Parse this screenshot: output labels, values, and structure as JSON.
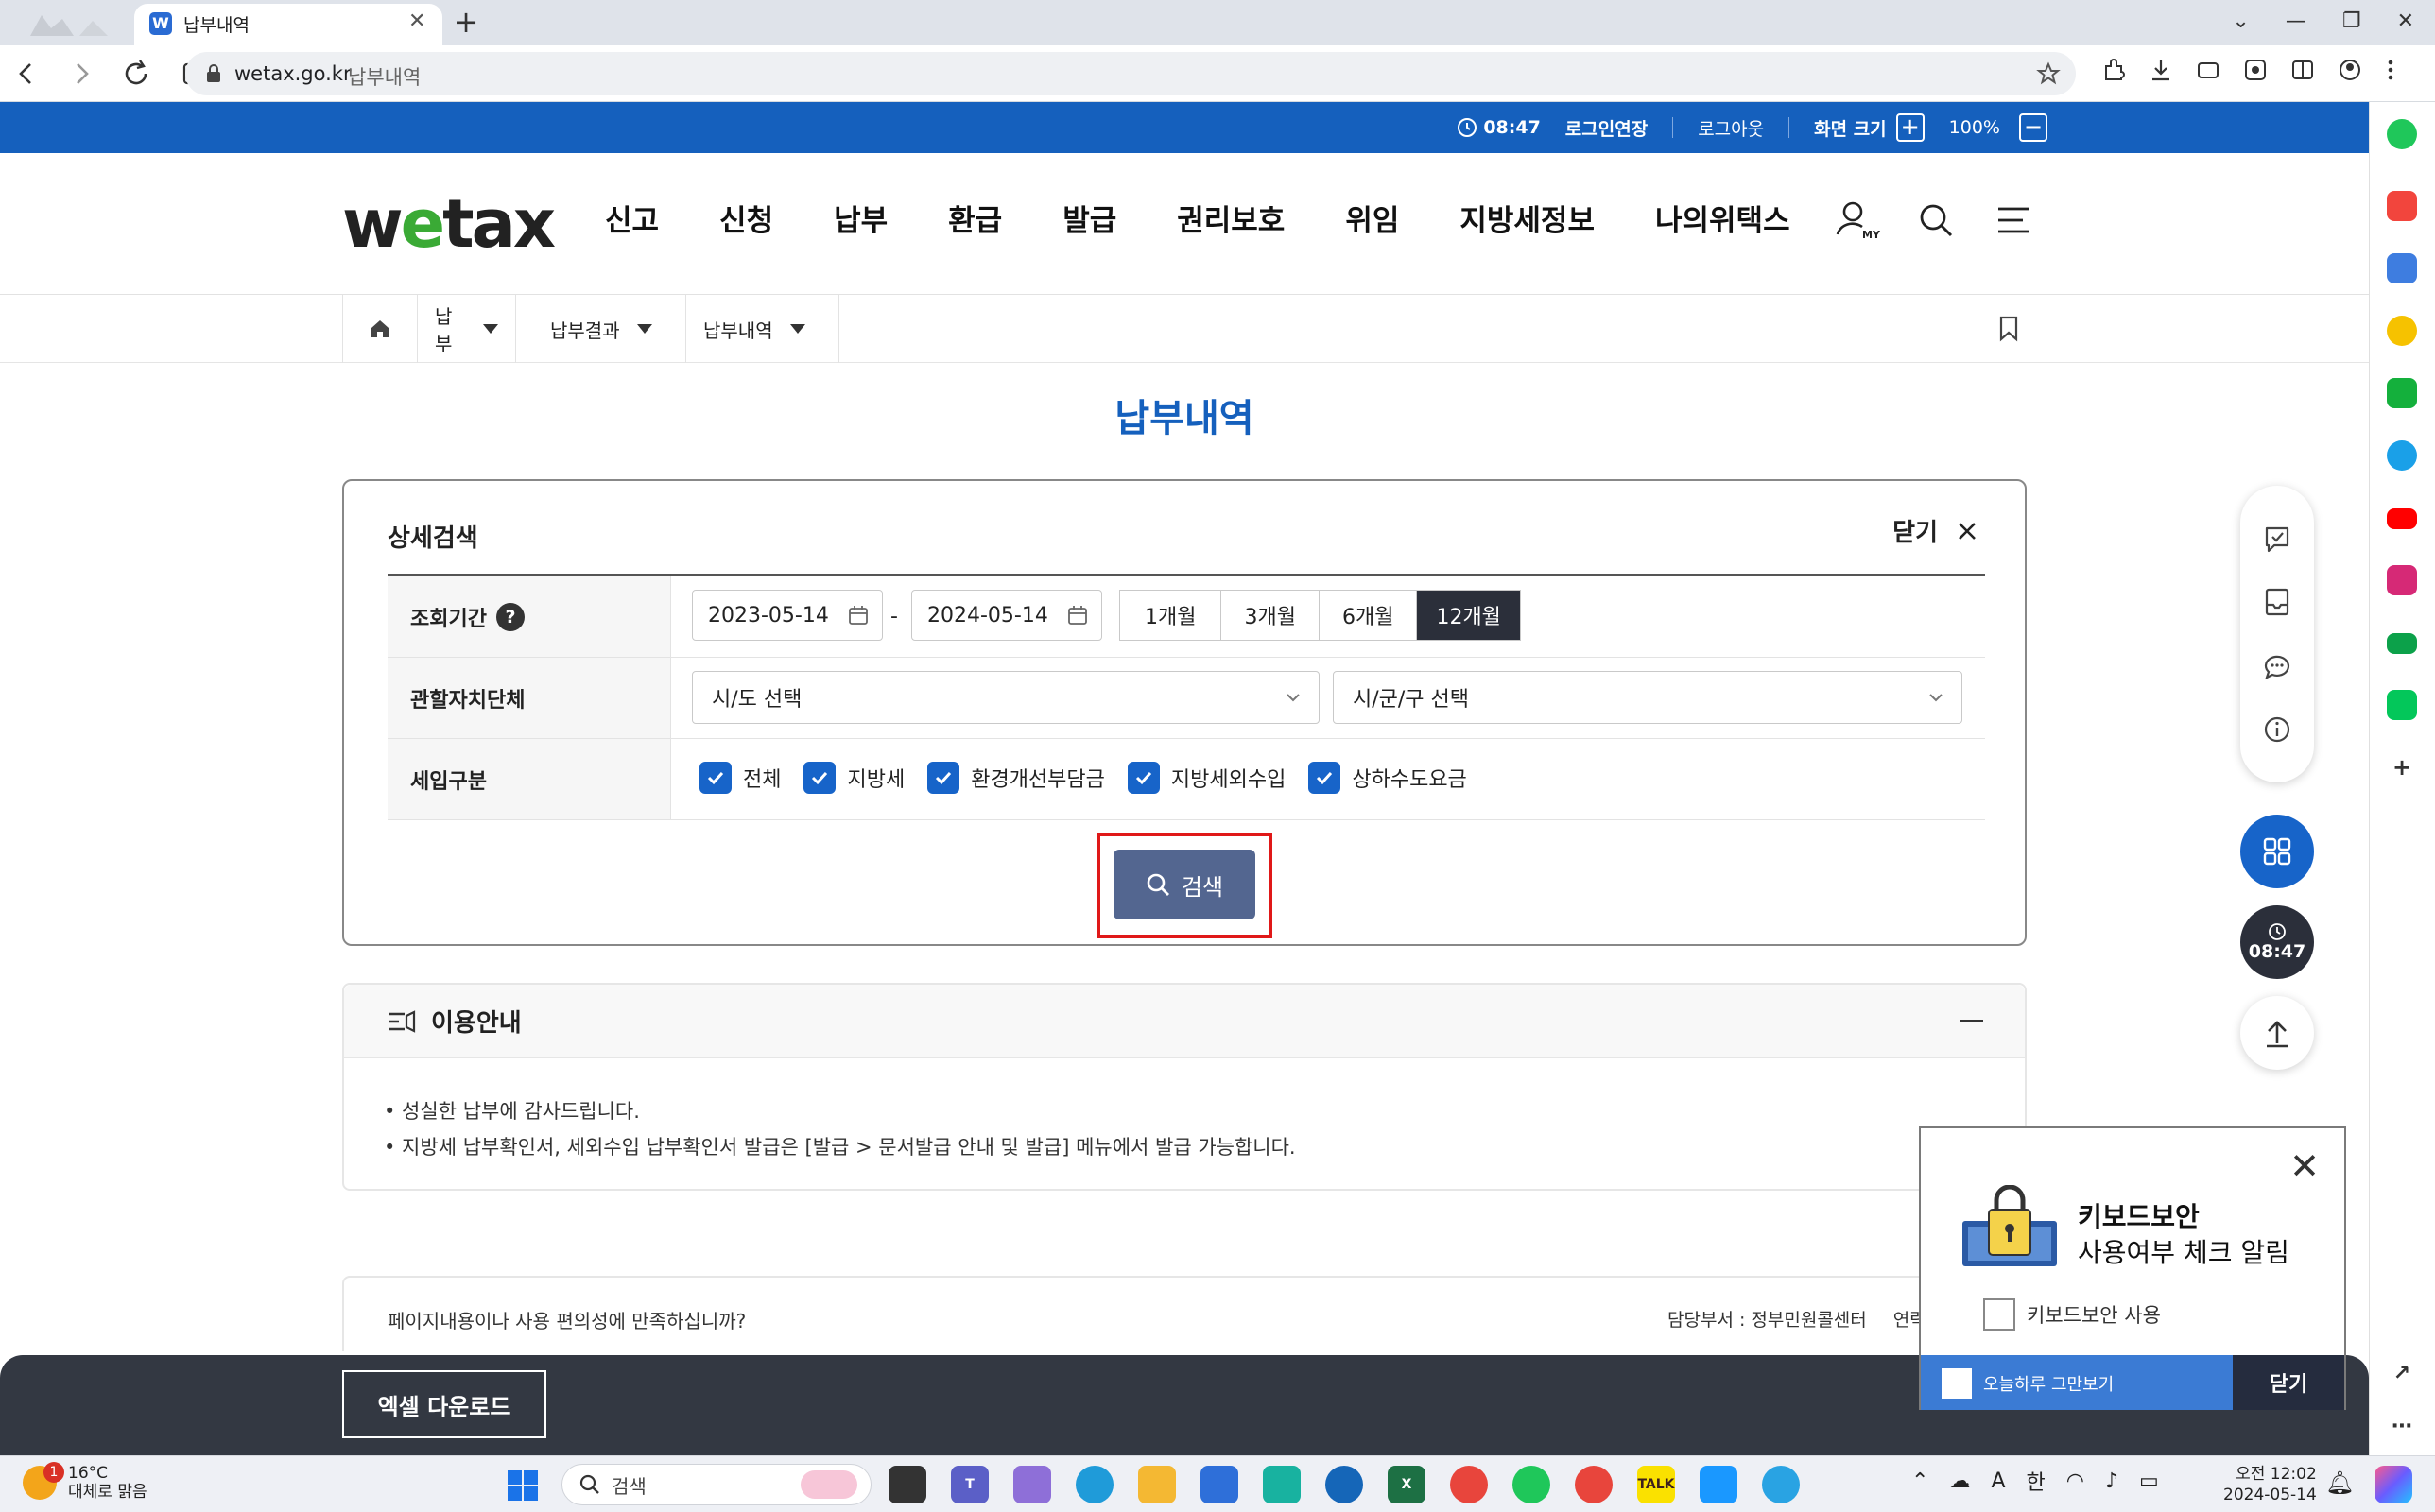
{
  "browser": {
    "tab_title": "납부내역",
    "tab_favicon": "W",
    "url_host": "wetax.go.kr",
    "url_title": "납부내역"
  },
  "topbar": {
    "time": "08:47",
    "extend_login": "로그인연장",
    "logout": "로그아웃",
    "screen_size": "화면 크기",
    "zoom": "100%"
  },
  "header": {
    "logo": {
      "w": "w",
      "e": "e",
      "tax": "tax"
    },
    "nav": [
      "신고",
      "신청",
      "납부",
      "환급",
      "발급",
      "권리보호",
      "위임",
      "지방세정보",
      "나의위택스"
    ],
    "my_label": "MY"
  },
  "breadcrumb": [
    "납부",
    "납부결과",
    "납부내역"
  ],
  "page_title": "납부내역",
  "search_panel": {
    "title": "상세검색",
    "close_label": "닫기",
    "period_label": "조회기간",
    "help": "?",
    "date_from": "2023-05-14",
    "date_to": "2024-05-14",
    "range_options": [
      "1개월",
      "3개월",
      "6개월",
      "12개월"
    ],
    "range_selected": "12개월",
    "authority_label": "관할자치단체",
    "sido_placeholder": "시/도 선택",
    "sigungu_placeholder": "시/군/구 선택",
    "revenue_label": "세입구분",
    "revenue_options": [
      "전체",
      "지방세",
      "환경개선부담금",
      "지방세외수입",
      "상하수도요금"
    ],
    "search_button": "검색"
  },
  "info": {
    "title": "이용안내",
    "lines": [
      "• 성실한 납부에 감사드립니다.",
      "• 지방세 납부확인서, 세외수입 납부확인서 발급은 [발급 > 문서발급 안내 및 발급] 메뉴에서 발급 가능합니다."
    ]
  },
  "feedback": {
    "question": "페이지내용이나 사용 편의성에 만족하십니까?",
    "department": "담당부서 : 정부민원콜센터",
    "contact": "연락"
  },
  "bottom_bar": {
    "excel_button": "엑셀 다운로드"
  },
  "quick": {
    "time": "08:47"
  },
  "keyboard_popup": {
    "title": "키보드보안",
    "subtitle": "사용여부 체크 알림",
    "checkbox_label": "키보드보안 사용",
    "today_hide": "오늘하루 그만보기",
    "close": "닫기"
  },
  "taskbar": {
    "temperature": "16°C",
    "weather": "대체로 맑음",
    "weather_badge": "1",
    "search_placeholder": "검색",
    "ime": "한",
    "font_a": "A",
    "time": "오전 12:02",
    "date": "2024-05-14"
  },
  "colors": {
    "brand_blue": "#1560bd",
    "logo_green": "#3aaa35",
    "checkbox_blue": "#1764c9",
    "search_button": "#536690",
    "highlight_red": "#e01818"
  }
}
